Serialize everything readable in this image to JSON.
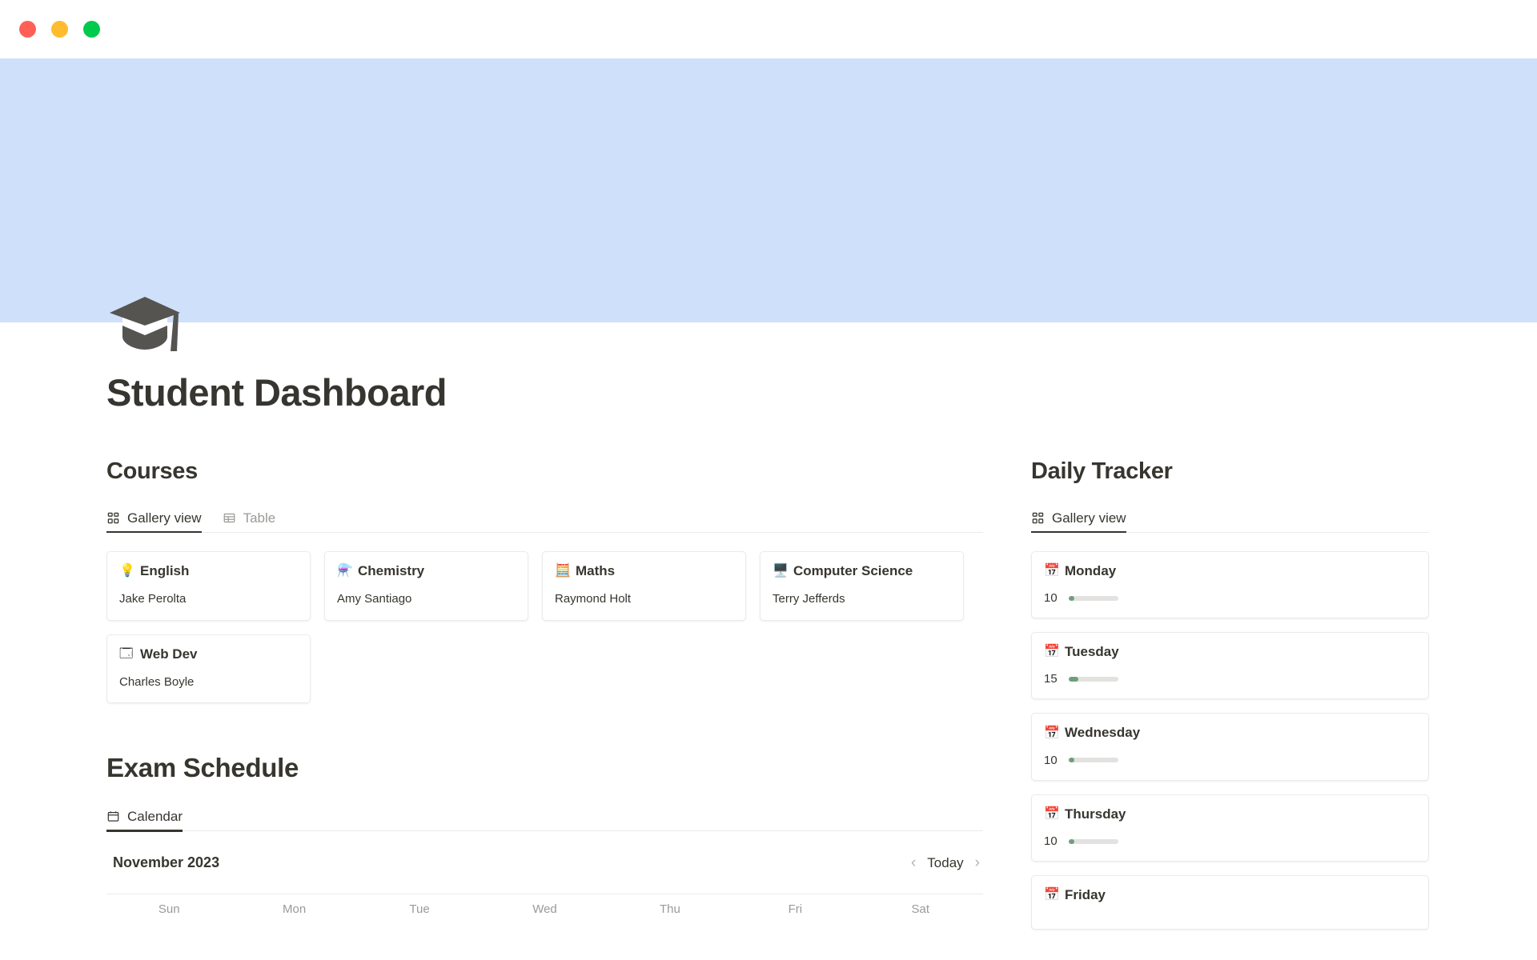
{
  "window": {
    "controls": [
      {
        "name": "close",
        "color": "#ff5f57"
      },
      {
        "name": "minimize",
        "color": "#febc2e"
      },
      {
        "name": "maximize",
        "color": "#00ca4e"
      }
    ]
  },
  "cover": {
    "color": "#cfe0fa"
  },
  "page": {
    "icon": "graduation-cap",
    "title": "Student Dashboard"
  },
  "courses": {
    "heading": "Courses",
    "tabs": [
      {
        "label": "Gallery view",
        "icon": "gallery-icon",
        "active": true
      },
      {
        "label": "Table",
        "icon": "table-icon",
        "active": false
      }
    ],
    "cards": [
      {
        "emoji": "💡",
        "icon": "lightbulb-icon",
        "title": "English",
        "teacher": "Jake Perolta"
      },
      {
        "emoji": "⚗️",
        "icon": "flask-icon",
        "title": "Chemistry",
        "teacher": "Amy Santiago"
      },
      {
        "emoji": "🧮",
        "icon": "abacus-icon",
        "title": "Maths",
        "teacher": "Raymond Holt"
      },
      {
        "emoji": "🖥️",
        "icon": "desktop-computer-icon",
        "title": "Computer Science",
        "teacher": "Terry Jefferds"
      },
      {
        "emoji": "🗔️",
        "icon": "code-window-icon",
        "title": "Web Dev",
        "teacher": "Charles Boyle"
      }
    ]
  },
  "daily_tracker": {
    "heading": "Daily Tracker",
    "tabs": [
      {
        "label": "Gallery view",
        "icon": "gallery-icon",
        "active": true
      }
    ],
    "bar_color": "#6f9e7d",
    "cards": [
      {
        "emoji": "📅",
        "icon": "calendar-icon",
        "day": "Monday",
        "value": "10",
        "percent": 12
      },
      {
        "emoji": "📅",
        "icon": "calendar-icon",
        "day": "Tuesday",
        "value": "15",
        "percent": 19
      },
      {
        "emoji": "📅",
        "icon": "calendar-icon",
        "day": "Wednesday",
        "value": "10",
        "percent": 12
      },
      {
        "emoji": "📅",
        "icon": "calendar-icon",
        "day": "Thursday",
        "value": "10",
        "percent": 12
      },
      {
        "emoji": "📅",
        "icon": "calendar-icon",
        "day": "Friday",
        "value": "",
        "percent": 0
      }
    ]
  },
  "exam_schedule": {
    "heading": "Exam Schedule",
    "tabs": [
      {
        "label": "Calendar",
        "icon": "calendar-view-icon",
        "active": true
      }
    ],
    "month": "November 2023",
    "today_label": "Today",
    "prev_icon": "chevron-left-icon",
    "next_icon": "chevron-right-icon",
    "weekdays": [
      "Sun",
      "Mon",
      "Tue",
      "Wed",
      "Thu",
      "Fri",
      "Sat"
    ]
  }
}
